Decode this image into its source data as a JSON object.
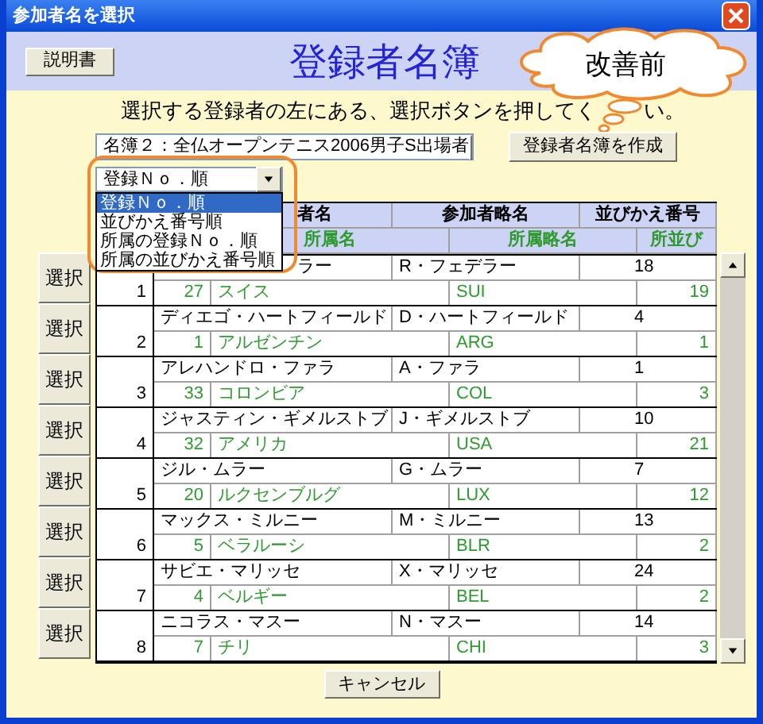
{
  "window": {
    "title": "参加者名を選択"
  },
  "help_button": "説明書",
  "heading": "登録者名簿",
  "callout": {
    "text": "改善前"
  },
  "instruction": {
    "before": "選択する登録者の左にある、選択ボタンを押してく",
    "after": "い。"
  },
  "roster_select": {
    "value": "名簿２：全仏オープンテニス2006男子S出場者"
  },
  "create_button": "登録者名簿を作成",
  "sort_select": {
    "value": "登録Ｎｏ．順",
    "expanded": true,
    "options": [
      {
        "label": "登録Ｎｏ．順",
        "selected": true
      },
      {
        "label": "並びかえ番号順",
        "selected": false
      },
      {
        "label": "所属の登録Ｎｏ．順",
        "selected": false
      },
      {
        "label": "所属の並びかえ番号順",
        "selected": false
      }
    ]
  },
  "table": {
    "columns": [
      "者名",
      "参加者略名",
      "並びかえ番号"
    ],
    "subcolumns": [
      "所属名",
      "所属略名",
      "所並び"
    ],
    "rows": [
      {
        "select": "選択",
        "no": "1",
        "name": "ラー",
        "short": "R・フェデラー",
        "sort": "18",
        "aff_no": "27",
        "aff": "スイス",
        "aff_short": "SUI",
        "aff_sort": "19"
      },
      {
        "select": "選択",
        "no": "2",
        "name": "ディエゴ・ハートフィールド",
        "short": "D・ハートフィールド",
        "sort": "4",
        "aff_no": "1",
        "aff": "アルゼンチン",
        "aff_short": "ARG",
        "aff_sort": "1"
      },
      {
        "select": "選択",
        "no": "3",
        "name": "アレハンドロ・ファラ",
        "short": "A・ファラ",
        "sort": "1",
        "aff_no": "33",
        "aff": "コロンビア",
        "aff_short": "COL",
        "aff_sort": "3"
      },
      {
        "select": "選択",
        "no": "4",
        "name": "ジャスティン・ギメルストブ",
        "short": "J・ギメルストブ",
        "sort": "10",
        "aff_no": "32",
        "aff": "アメリカ",
        "aff_short": "USA",
        "aff_sort": "21"
      },
      {
        "select": "選択",
        "no": "5",
        "name": "ジル・ムラー",
        "short": "G・ムラー",
        "sort": "7",
        "aff_no": "20",
        "aff": "ルクセンブルグ",
        "aff_short": "LUX",
        "aff_sort": "12"
      },
      {
        "select": "選択",
        "no": "6",
        "name": "マックス・ミルニー",
        "short": "M・ミルニー",
        "sort": "13",
        "aff_no": "5",
        "aff": "ベラルーシ",
        "aff_short": "BLR",
        "aff_sort": "2"
      },
      {
        "select": "選択",
        "no": "7",
        "name": "サビエ・マリッセ",
        "short": "X・マリッセ",
        "sort": "24",
        "aff_no": "4",
        "aff": "ベルギー",
        "aff_short": "BEL",
        "aff_sort": "2"
      },
      {
        "select": "選択",
        "no": "8",
        "name": "ニコラス・マスー",
        "short": "N・マスー",
        "sort": "14",
        "aff_no": "7",
        "aff": "チリ",
        "aff_short": "CHI",
        "aff_sort": "3"
      }
    ]
  },
  "cancel_button": "キャンセル"
}
